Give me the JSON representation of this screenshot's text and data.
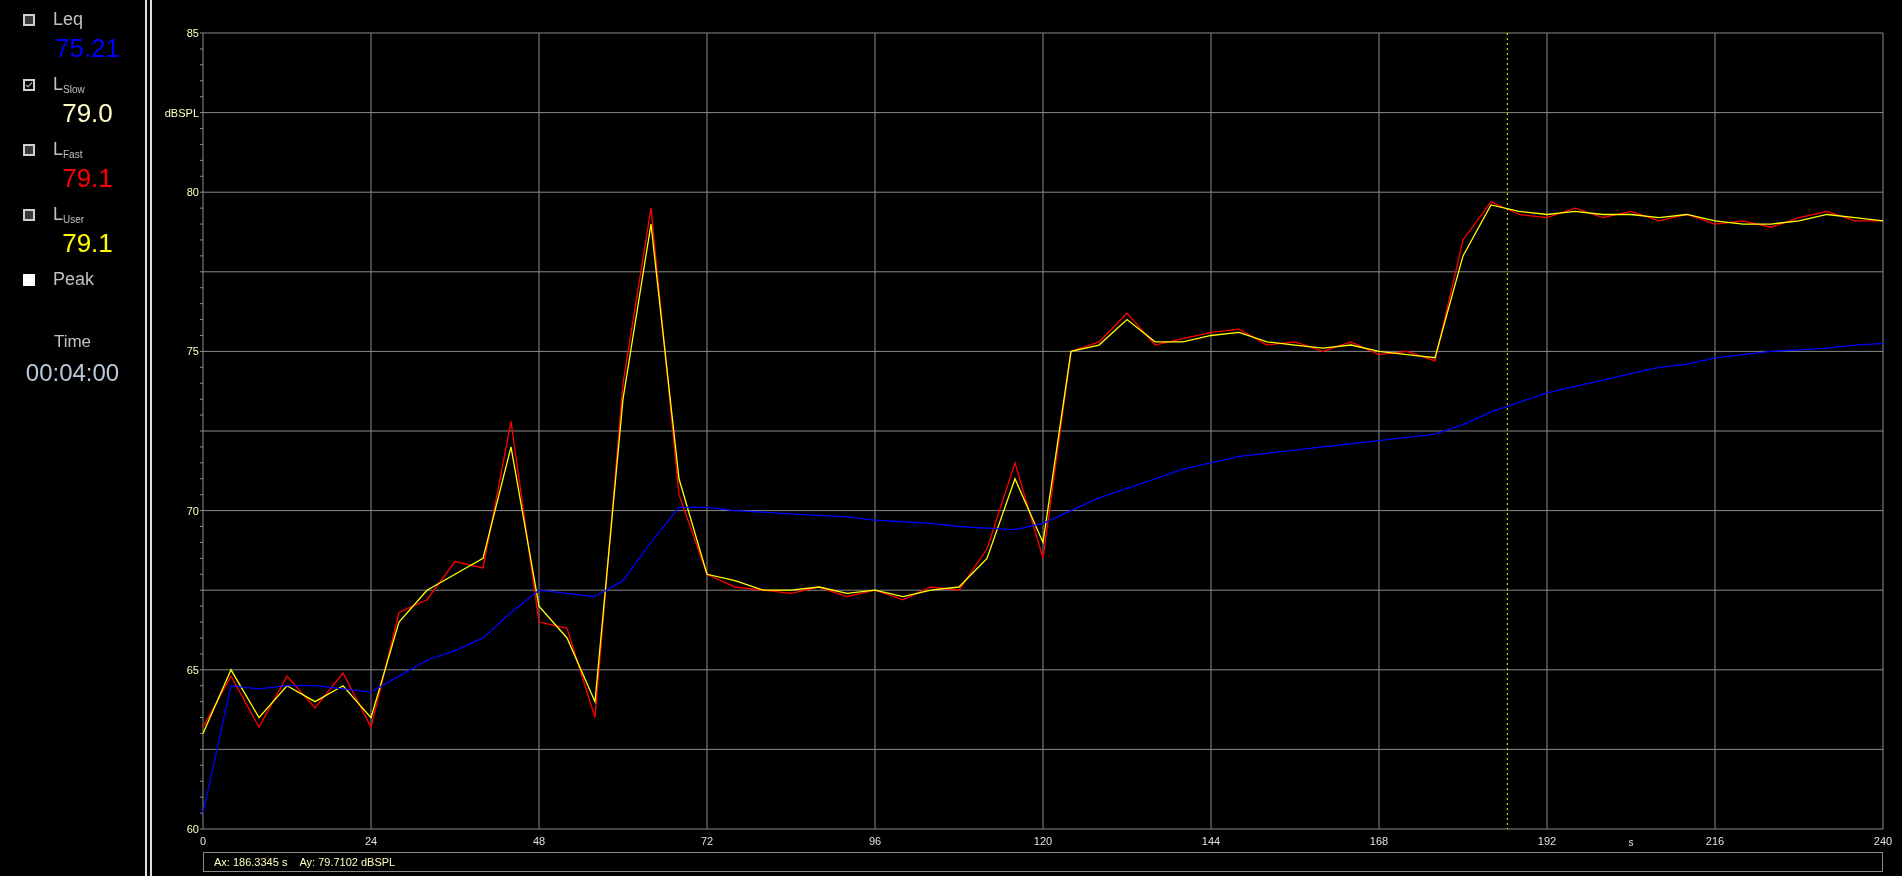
{
  "meters": [
    {
      "kind": "meter",
      "label": "Leq",
      "checked": false,
      "value": "75.21",
      "color": "#0000ff"
    },
    {
      "kind": "meter",
      "label": "L$_{Slow}$",
      "checked": true,
      "value": "79.0",
      "color": "#ffffc8"
    },
    {
      "kind": "meter",
      "label": "L$_{Fast}$",
      "checked": false,
      "value": "79.1",
      "color": "#ff0000"
    },
    {
      "kind": "meter",
      "label": "L$_{User}$",
      "checked": false,
      "value": "79.1",
      "color": "#ffff00"
    },
    {
      "kind": "toggle",
      "label": "Peak",
      "checked": false
    }
  ],
  "time": {
    "label": "Time",
    "value": "00:04:00"
  },
  "chart": {
    "chart_data": {
      "type": "line",
      "ylabel": "dBSPL",
      "xlabel": "s",
      "xlim": [
        0,
        240
      ],
      "ylim": [
        60,
        85
      ],
      "xticks": [
        0,
        24,
        48,
        72,
        96,
        120,
        144,
        168,
        192,
        216,
        240
      ],
      "yticks": [
        60,
        65,
        70,
        75,
        80,
        85
      ],
      "x": [
        0,
        4,
        8,
        12,
        16,
        20,
        24,
        28,
        32,
        36,
        40,
        44,
        48,
        52,
        56,
        60,
        64,
        68,
        72,
        76,
        80,
        84,
        88,
        92,
        96,
        100,
        104,
        108,
        112,
        116,
        120,
        124,
        128,
        132,
        136,
        140,
        144,
        148,
        152,
        156,
        160,
        164,
        168,
        172,
        176,
        180,
        184,
        188,
        192,
        196,
        200,
        204,
        208,
        212,
        216,
        220,
        224,
        228,
        232,
        236,
        240
      ],
      "series": [
        {
          "color": "#ff0000",
          "values": [
            63.2,
            64.8,
            63.2,
            64.8,
            63.8,
            64.9,
            63.2,
            66.8,
            67.2,
            68.4,
            68.2,
            72.8,
            66.5,
            66.3,
            63.5,
            74.0,
            79.5,
            70.5,
            68.0,
            67.6,
            67.5,
            67.4,
            67.6,
            67.3,
            67.5,
            67.2,
            67.6,
            67.5,
            68.8,
            71.5,
            68.5,
            75.0,
            75.3,
            76.2,
            75.2,
            75.4,
            75.6,
            75.7,
            75.2,
            75.3,
            75.0,
            75.3,
            74.9,
            75.0,
            74.7,
            78.5,
            79.7,
            79.3,
            79.2,
            79.5,
            79.2,
            79.4,
            79.1,
            79.3,
            79.0,
            79.1,
            78.9,
            79.2,
            79.4,
            79.1,
            79.1
          ]
        },
        {
          "color": "#ffff00",
          "values": [
            63.0,
            65.0,
            63.5,
            64.5,
            64.0,
            64.5,
            63.5,
            66.5,
            67.5,
            68.0,
            68.5,
            72.0,
            67.0,
            66.0,
            64.0,
            73.5,
            79.0,
            71.0,
            68.0,
            67.8,
            67.5,
            67.5,
            67.6,
            67.4,
            67.5,
            67.3,
            67.5,
            67.6,
            68.5,
            71.0,
            69.0,
            75.0,
            75.2,
            76.0,
            75.3,
            75.3,
            75.5,
            75.6,
            75.3,
            75.2,
            75.1,
            75.2,
            75.0,
            74.9,
            74.8,
            78.0,
            79.6,
            79.4,
            79.3,
            79.4,
            79.3,
            79.3,
            79.2,
            79.3,
            79.1,
            79.0,
            79.0,
            79.1,
            79.3,
            79.2,
            79.1
          ]
        },
        {
          "color": "#0000ff",
          "values": [
            60.5,
            64.5,
            64.4,
            64.5,
            64.5,
            64.4,
            64.3,
            64.8,
            65.3,
            65.6,
            66.0,
            66.8,
            67.5,
            67.4,
            67.3,
            67.8,
            69.0,
            70.1,
            70.1,
            70.0,
            69.95,
            69.9,
            69.85,
            69.8,
            69.7,
            69.65,
            69.6,
            69.5,
            69.45,
            69.4,
            69.6,
            70.0,
            70.4,
            70.7,
            71.0,
            71.3,
            71.5,
            71.7,
            71.8,
            71.9,
            72.0,
            72.1,
            72.2,
            72.3,
            72.4,
            72.7,
            73.1,
            73.4,
            73.7,
            73.9,
            74.1,
            74.3,
            74.5,
            74.6,
            74.8,
            74.9,
            75.0,
            75.05,
            75.1,
            75.2,
            75.25
          ]
        }
      ],
      "grid": true,
      "ref_lines": [
        {
          "axis": "x",
          "value": 186.3345,
          "color": "#ffff00"
        }
      ]
    }
  },
  "status_bar": {
    "x_readout": "Ax: 186.3345 s",
    "y_readout": "Ay: 79.7102 dBSPL"
  }
}
